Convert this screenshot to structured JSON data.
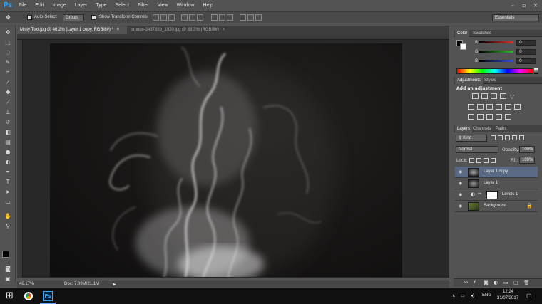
{
  "menubar": {
    "logo": "Ps",
    "items": [
      "File",
      "Edit",
      "Image",
      "Layer",
      "Type",
      "Select",
      "Filter",
      "View",
      "Window",
      "Help"
    ],
    "minimize": "–",
    "maximize": "▫",
    "close": "✕"
  },
  "options": {
    "auto_select_label": "Auto-Select:",
    "auto_select_value": "Group",
    "transform_label": "Show Transform Controls",
    "workspace": "Essentials"
  },
  "tabs": [
    {
      "label": "Misty Text.jpg @ 46.2% (Layer 1 copy, RGB/8#) *",
      "close": "×"
    },
    {
      "label": "smoke-243788b_1920.jpg @ 33.3% (RGB/8#)",
      "close": "×"
    }
  ],
  "status": {
    "zoom": "46.17%",
    "doc": "Doc: 7.03M/21.1M"
  },
  "color_panel": {
    "tabs": [
      "Color",
      "Swatches"
    ],
    "r_label": "R",
    "g_label": "G",
    "b_label": "B",
    "r_value": "0",
    "g_value": "0",
    "b_value": "0",
    "accent_r": "#e03030",
    "accent_g": "#30c030",
    "accent_b": "#3050e0"
  },
  "adjustments": {
    "tabs": [
      "Adjustments",
      "Styles"
    ],
    "heading": "Add an adjustment"
  },
  "layers_panel": {
    "tabs": [
      "Layers",
      "Channels",
      "Paths"
    ],
    "filter": "Kind",
    "blend": "Normal",
    "opacity_label": "Opacity:",
    "opacity_value": "100%",
    "lock_label": "Lock:",
    "fill_label": "Fill:",
    "fill_value": "100%",
    "layers": [
      {
        "name": "Layer 1 copy",
        "selected": true
      },
      {
        "name": "Layer 1",
        "selected": false
      },
      {
        "name": "Levels 1",
        "selected": false
      },
      {
        "name": "Background",
        "selected": false
      }
    ]
  },
  "taskbar": {
    "lang": "ENG",
    "time": "12:24",
    "date": "31/07/2017"
  }
}
